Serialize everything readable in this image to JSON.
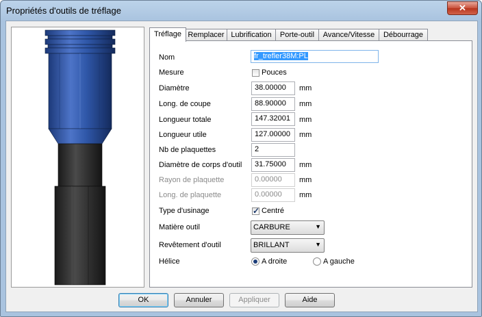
{
  "window": {
    "title": "Propriétés d'outils de tréflage",
    "close_label": "✕"
  },
  "tabs": [
    {
      "label": "Tréflage"
    },
    {
      "label": "Remplacer"
    },
    {
      "label": "Lubrification"
    },
    {
      "label": "Porte-outil"
    },
    {
      "label": "Avance/Vitesse"
    },
    {
      "label": "Débourrage"
    }
  ],
  "form": {
    "nom_label": "Nom",
    "nom_value": "fr_trefler38M:PL",
    "mesure_label": "Mesure",
    "pouces_label": "Pouces",
    "pouces_checked": false,
    "diametre_label": "Diamètre",
    "diametre_value": "38.00000",
    "long_coupe_label": "Long. de coupe",
    "long_coupe_value": "88.90000",
    "longueur_totale_label": "Longueur totale",
    "longueur_totale_value": "147.32001",
    "longueur_utile_label": "Longueur utile",
    "longueur_utile_value": "127.00000",
    "nb_plaquettes_label": "Nb de plaquettes",
    "nb_plaquettes_value": "2",
    "diametre_corps_label": "Diamètre de corps d'outil",
    "diametre_corps_value": "31.75000",
    "rayon_plaquette_label": "Rayon de plaquette",
    "rayon_plaquette_value": "0.00000",
    "long_plaquette_label": "Long. de plaquette",
    "long_plaquette_value": "0.00000",
    "unit": "mm",
    "type_usinage_label": "Type d'usinage",
    "centre_label": "Centré",
    "centre_checked": true,
    "matiere_label": "Matière outil",
    "matiere_value": "CARBURE",
    "revetement_label": "Revêtement d'outil",
    "revetement_value": "BRILLANT",
    "helice_label": "Hélice",
    "a_droite_label": "A droite",
    "a_gauche_label": "A gauche",
    "helice_selected": "A droite"
  },
  "buttons": {
    "ok": "OK",
    "annuler": "Annuler",
    "appliquer": "Appliquer",
    "aide": "Aide"
  },
  "colors": {
    "tool_holder_blue": "#2c4f99",
    "tool_shank_dark": "#2f2f2f",
    "selection": "#3399ff"
  }
}
